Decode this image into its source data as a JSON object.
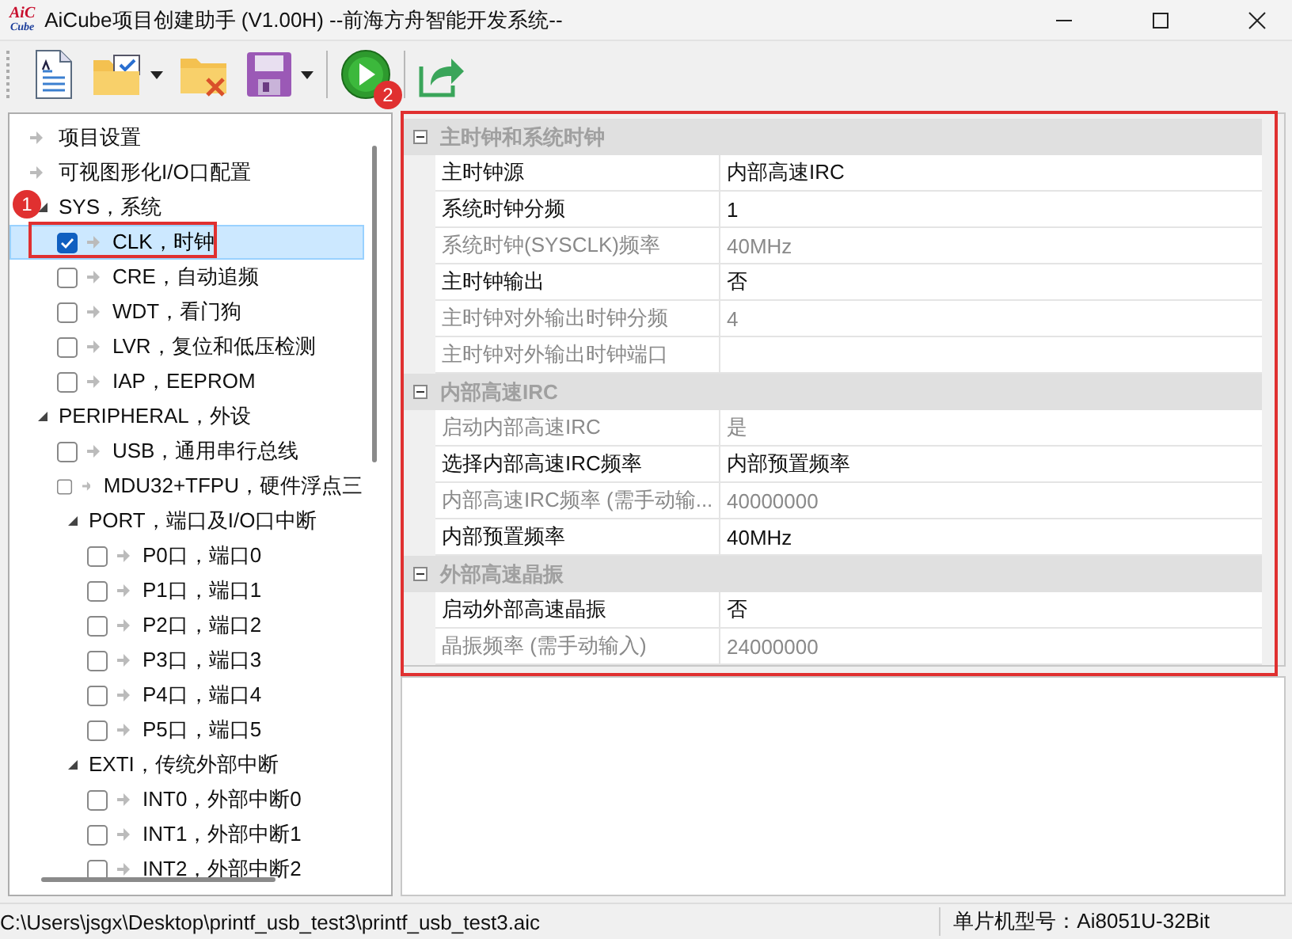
{
  "window": {
    "title": "AiCube项目创建助手 (V1.00H) --前海方舟智能开发系统--",
    "logo": [
      "AiC",
      "Cube"
    ]
  },
  "toolbar": [
    {
      "kind": "new",
      "dropdown": false
    },
    {
      "kind": "open",
      "dropdown": true
    },
    {
      "kind": "close",
      "dropdown": false
    },
    {
      "kind": "save",
      "dropdown": true
    },
    {
      "kind": "run",
      "dropdown": false
    },
    {
      "kind": "export",
      "dropdown": false
    }
  ],
  "tree": [
    {
      "label": "项目设置",
      "kind": "page",
      "selected": false
    },
    {
      "label": "可视图形化I/O口配置",
      "kind": "page",
      "selected": false
    },
    {
      "label": "SYS，系统",
      "kind": "group",
      "expanded": true,
      "selected": false,
      "children": [
        {
          "label": "CLK，时钟",
          "kind": "module",
          "checked": true,
          "selected": true
        },
        {
          "label": "CRE，自动追频",
          "kind": "module",
          "checked": false,
          "selected": false
        },
        {
          "label": "WDT，看门狗",
          "kind": "module",
          "checked": false,
          "selected": false
        },
        {
          "label": "LVR，复位和低压检测",
          "kind": "module",
          "checked": false,
          "selected": false
        },
        {
          "label": "IAP，EEPROM",
          "kind": "module",
          "checked": false,
          "selected": false
        }
      ]
    },
    {
      "label": "PERIPHERAL，外设",
      "kind": "group",
      "expanded": true,
      "selected": false,
      "children": [
        {
          "label": "USB，通用串行总线",
          "kind": "module",
          "checked": false,
          "selected": false
        },
        {
          "label": "MDU32+TFPU，硬件浮点三",
          "kind": "module",
          "checked": false,
          "selected": false
        },
        {
          "label": "PORT，端口及I/O口中断",
          "kind": "group",
          "expanded": true,
          "selected": false,
          "children": [
            {
              "label": "P0口，端口0",
              "kind": "module",
              "checked": false,
              "selected": false
            },
            {
              "label": "P1口，端口1",
              "kind": "module",
              "checked": false,
              "selected": false
            },
            {
              "label": "P2口，端口2",
              "kind": "module",
              "checked": false,
              "selected": false
            },
            {
              "label": "P3口，端口3",
              "kind": "module",
              "checked": false,
              "selected": false
            },
            {
              "label": "P4口，端口4",
              "kind": "module",
              "checked": false,
              "selected": false
            },
            {
              "label": "P5口，端口5",
              "kind": "module",
              "checked": false,
              "selected": false
            }
          ]
        },
        {
          "label": "EXTI，传统外部中断",
          "kind": "group",
          "expanded": true,
          "selected": false,
          "children": [
            {
              "label": "INT0，外部中断0",
              "kind": "module",
              "checked": false,
              "selected": false
            },
            {
              "label": "INT1，外部中断1",
              "kind": "module",
              "checked": false,
              "selected": false
            },
            {
              "label": "INT2，外部中断2",
              "kind": "module",
              "checked": false,
              "selected": false
            }
          ]
        }
      ]
    }
  ],
  "properties": [
    {
      "category": "主时钟和系统时钟",
      "expanded": true,
      "rows": [
        {
          "name": "主时钟源",
          "value": "内部高速IRC",
          "readonly": false
        },
        {
          "name": "系统时钟分频",
          "value": "1",
          "readonly": false
        },
        {
          "name": "系统时钟(SYSCLK)频率",
          "value": "40MHz",
          "readonly": true
        },
        {
          "name": "主时钟输出",
          "value": "否",
          "readonly": false
        },
        {
          "name": "主时钟对外输出时钟分频",
          "value": "4",
          "readonly": true
        },
        {
          "name": "主时钟对外输出时钟端口",
          "readonly": true
        }
      ]
    },
    {
      "category": "内部高速IRC",
      "expanded": true,
      "rows": [
        {
          "name": "启动内部高速IRC",
          "value": "是",
          "readonly": true
        },
        {
          "name": "选择内部高速IRC频率",
          "value": "内部预置频率",
          "readonly": false
        },
        {
          "name": "内部高速IRC频率 (需手动输...",
          "value": "40000000",
          "readonly": true
        },
        {
          "name": "内部预置频率",
          "value": "40MHz",
          "readonly": false
        }
      ]
    },
    {
      "category": "外部高速晶振",
      "expanded": true,
      "rows": [
        {
          "name": "启动外部高速晶振",
          "value": "否",
          "readonly": false
        },
        {
          "name": "晶振频率 (需手动输入)",
          "value": "24000000",
          "readonly": true
        }
      ]
    }
  ],
  "annotations": [
    {
      "label": "1"
    },
    {
      "label": "2"
    }
  ],
  "status_bar": {
    "path": "C:\\Users\\jsgx\\Desktop\\printf_usb_test3\\printf_usb_test3.aic",
    "model": "单片机型号：Ai8051U-32Bit"
  }
}
